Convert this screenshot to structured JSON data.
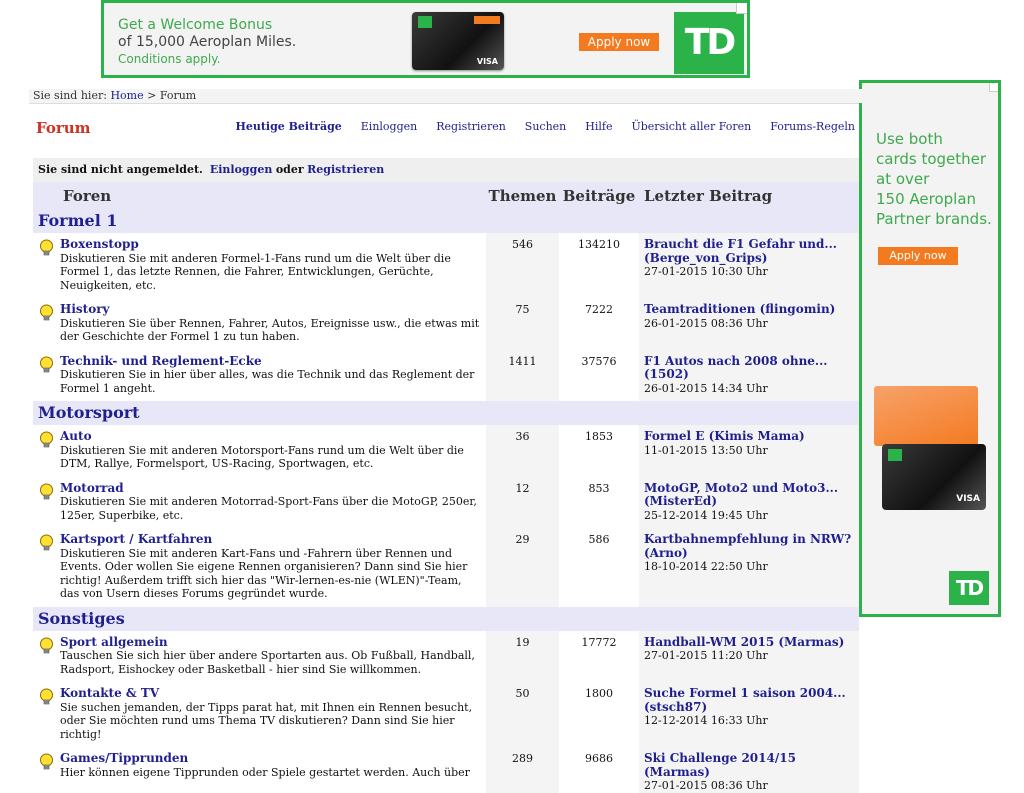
{
  "top_ad": {
    "line1": "Get a Welcome Bonus",
    "line2": "of 15,000 Aeroplan Miles.",
    "line3": "Conditions apply.",
    "apply": "Apply now",
    "logo": "TD",
    "card_visa": "VISA",
    "brand_color": "#2bb34a",
    "accent_color": "#f47a20"
  },
  "side_ad": {
    "lines": [
      "Use both",
      "cards together",
      "at over",
      "150 Aeroplan",
      "Partner brands."
    ],
    "apply": "Apply now",
    "logo": "TD",
    "card_visa": "VISA"
  },
  "breadcrumb": {
    "prefix": "Sie sind hier:",
    "home": "Home",
    "sep": ">",
    "current": "Forum"
  },
  "header": {
    "title": "Forum",
    "nav": [
      "Heutige Beiträge",
      "Einloggen",
      "Registrieren",
      "Suchen",
      "Hilfe",
      "Übersicht aller Foren",
      "Forums-Regeln"
    ]
  },
  "notice": {
    "text": "Sie sind nicht angemeldet.",
    "login": "Einloggen",
    "or": "oder",
    "register": "Registrieren"
  },
  "table": {
    "headers": {
      "forums": "Foren",
      "topics": "Themen",
      "posts": "Beiträge",
      "last": "Letzter Beitrag"
    },
    "sections": [
      {
        "name": "Formel 1",
        "forums": [
          {
            "title": "Boxenstopp",
            "desc": "Diskutieren Sie mit anderen Formel-1-Fans rund um die Welt über die Formel 1, das letzte Rennen, die Fahrer, Entwicklungen, Gerüchte, Neuigkeiten, etc.",
            "topics": "546",
            "posts": "134210",
            "last_title": "Braucht die F1 Gefahr und... (Berge_von_Grips)",
            "last_date": "27-01-2015 10:30 Uhr"
          },
          {
            "title": "History",
            "desc": "Diskutieren Sie über Rennen, Fahrer, Autos, Ereignisse usw., die etwas mit der Geschichte der Formel 1 zu tun haben.",
            "topics": "75",
            "posts": "7222",
            "last_title": "Teamtraditionen (flingomin)",
            "last_date": "26-01-2015 08:36 Uhr"
          },
          {
            "title": "Technik- und Reglement-Ecke",
            "desc": "Diskutieren Sie in hier über alles, was die Technik und das Reglement der Formel 1 angeht.",
            "topics": "1411",
            "posts": "37576",
            "last_title": "F1 Autos nach 2008 ohne... (1502)",
            "last_date": "26-01-2015 14:34 Uhr"
          }
        ]
      },
      {
        "name": "Motorsport",
        "forums": [
          {
            "title": "Auto",
            "desc": "Diskutieren Sie mit anderen Motorsport-Fans rund um die Welt über die DTM, Rallye, Formelsport, US-Racing, Sportwagen, etc.",
            "topics": "36",
            "posts": "1853",
            "last_title": "Formel E (Kimis Mama)",
            "last_date": "11-01-2015 13:50 Uhr"
          },
          {
            "title": "Motorrad",
            "desc": "Diskutieren Sie mit anderen Motorrad-Sport-Fans über die MotoGP, 250er, 125er, Superbike, etc.",
            "topics": "12",
            "posts": "853",
            "last_title": "MotoGP, Moto2 und Moto3... (MisterEd)",
            "last_date": "25-12-2014 19:45 Uhr"
          },
          {
            "title": "Kartsport / Kartfahren",
            "desc": "Diskutieren Sie mit anderen Kart-Fans und -Fahrern über Rennen und Events. Oder wollen Sie eigene Rennen organisieren? Dann sind Sie hier richtig! Außerdem trifft sich hier das \"Wir-lernen-es-nie (WLEN)\"-Team, das von Usern dieses Forums gegründet wurde.",
            "topics": "29",
            "posts": "586",
            "last_title": "Kartbahnempfehlung in NRW? (Arno)",
            "last_date": "18-10-2014 22:50 Uhr"
          }
        ]
      },
      {
        "name": "Sonstiges",
        "forums": [
          {
            "title": "Sport allgemein",
            "desc": "Tauschen Sie sich hier über andere Sportarten aus. Ob Fußball, Handball, Radsport, Eishockey oder Basketball - hier sind Sie willkommen.",
            "topics": "19",
            "posts": "17772",
            "last_title": "Handball-WM 2015 (Marmas)",
            "last_date": "27-01-2015 11:20 Uhr"
          },
          {
            "title": "Kontakte & TV",
            "desc": "Sie suchen jemanden, der Tipps parat hat, mit Ihnen ein Rennen besucht, oder Sie möchten rund ums Thema TV diskutieren? Dann sind Sie hier richtig!",
            "topics": "50",
            "posts": "1800",
            "last_title": "Suche Formel 1 saison 2004... (stsch87)",
            "last_date": "12-12-2014 16:33 Uhr"
          },
          {
            "title": "Games/Tipprunden",
            "desc": "Hier können eigene Tipprunden oder Spiele gestartet werden. Auch über",
            "topics": "289",
            "posts": "9686",
            "last_title": "Ski Challenge 2014/15 (Marmas)",
            "last_date": "27-01-2015 08:36 Uhr"
          }
        ]
      }
    ]
  }
}
